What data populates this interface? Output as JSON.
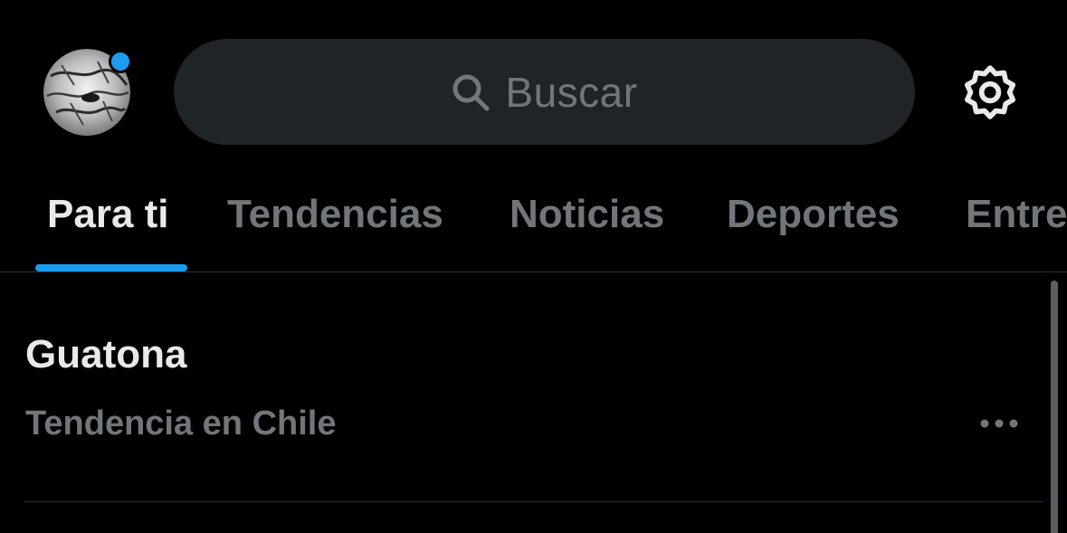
{
  "header": {
    "avatar_icon": "profile-avatar",
    "notification_color": "#1d9bf0",
    "search": {
      "placeholder": "Buscar",
      "icon": "search-icon"
    },
    "settings_icon": "gear-icon"
  },
  "tabs": [
    {
      "label": "Para ti",
      "active": true
    },
    {
      "label": "Tendencias",
      "active": false
    },
    {
      "label": "Noticias",
      "active": false
    },
    {
      "label": "Deportes",
      "active": false
    },
    {
      "label": "Entretenimiento",
      "active": false
    }
  ],
  "trends": [
    {
      "title": "Guatona",
      "meta": "Tendencia en Chile",
      "more_icon": "more-icon"
    }
  ],
  "colors": {
    "background": "#000000",
    "search_bg": "#202327",
    "primary_text": "#e7e9ea",
    "secondary_text": "#71767b",
    "accent": "#1d9bf0",
    "divider": "#2f3336"
  }
}
